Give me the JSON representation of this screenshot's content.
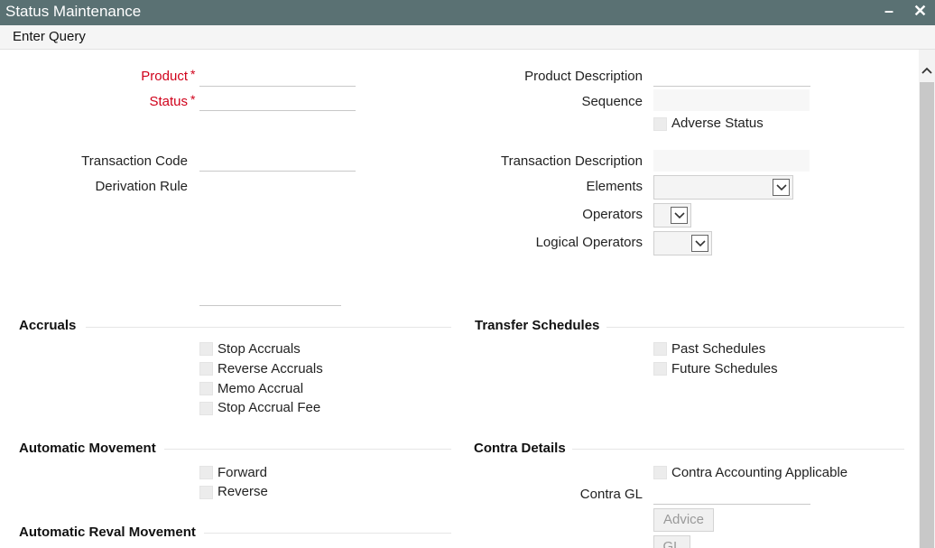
{
  "window": {
    "title": "Status Maintenance",
    "minimize_label": "–",
    "close_label": "✕"
  },
  "toolbar": {
    "enter_query_label": "Enter Query"
  },
  "header_fields": {
    "product_label": "Product",
    "product_value": "",
    "status_label": "Status",
    "status_value": "",
    "required_marker": "*",
    "product_description_label": "Product Description",
    "product_description_value": "",
    "sequence_label": "Sequence",
    "sequence_value": "",
    "adverse_status_label": "Adverse Status"
  },
  "transaction": {
    "transaction_code_label": "Transaction Code",
    "transaction_code_value": "",
    "transaction_description_label": "Transaction Description",
    "derivation_rule_label": "Derivation Rule",
    "elements_label": "Elements",
    "operators_label": "Operators",
    "logical_operators_label": "Logical Operators"
  },
  "accruals": {
    "heading": "Accruals",
    "items": [
      "Stop Accruals",
      "Reverse Accruals",
      "Memo Accrual",
      "Stop Accrual Fee"
    ]
  },
  "transfer_schedules": {
    "heading": "Transfer Schedules",
    "items": [
      "Past Schedules",
      "Future Schedules"
    ]
  },
  "automatic_movement": {
    "heading": "Automatic Movement",
    "items": [
      "Forward",
      "Reverse"
    ]
  },
  "contra_details": {
    "heading": "Contra Details",
    "contra_accounting_label": "Contra Accounting Applicable",
    "contra_gl_label": "Contra GL",
    "contra_gl_value": "",
    "advice_button": "Advice",
    "gl_button": "GL"
  },
  "automatic_reval": {
    "heading": "Automatic Reval Movement"
  },
  "icons": {
    "dropdown": "chevron-down-icon",
    "scroll_up": "chevron-up-icon"
  }
}
